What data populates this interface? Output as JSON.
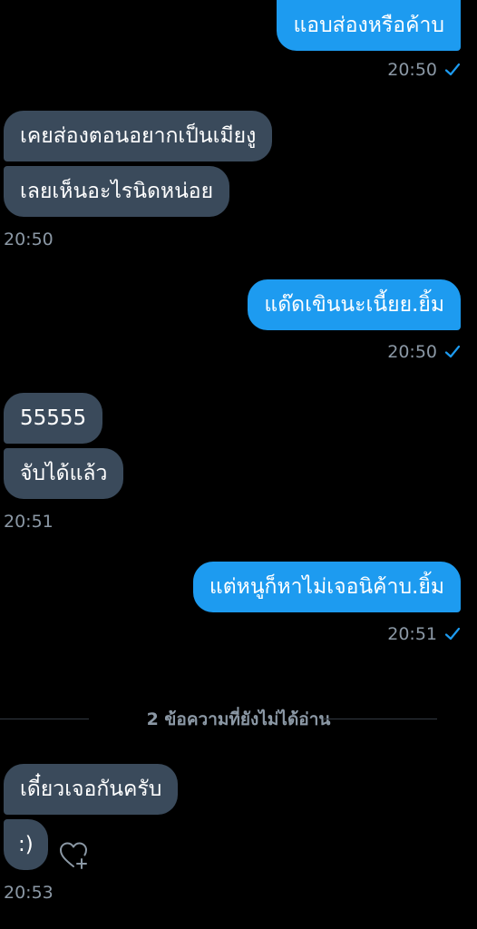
{
  "messages": [
    {
      "text": "แอบส่องหรือค้าบ"
    },
    {
      "text": "เคยส่องตอนอยากเป็นเมียงู"
    },
    {
      "text": "เลยเห็นอะไรนิดหน่อย"
    },
    {
      "text": "แด๊ดเขินนะเนี้ยย.ยิ้ม"
    },
    {
      "text": "55555"
    },
    {
      "text": "จับได้แล้ว"
    },
    {
      "text": "แต่หนูก็หาไม่เจอนิค้าบ.ยิ้ม"
    },
    {
      "text": "เดี๋ยวเจอกันครับ"
    },
    {
      "text": ":)"
    }
  ],
  "timestamps": [
    "20:50",
    "20:50",
    "20:50",
    "20:51",
    "20:51",
    "20:53"
  ],
  "divider": {
    "text": "2 ข้อความที่ยังไม่ได้อ่าน"
  },
  "icons": {
    "read_receipt": "checkmark-icon",
    "reaction": "heart-plus-icon"
  },
  "colors": {
    "background": "#000000",
    "outgoing_bubble": "#1d9bf0",
    "incoming_bubble": "#3a4a5b",
    "timestamp": "#8b98a5"
  }
}
